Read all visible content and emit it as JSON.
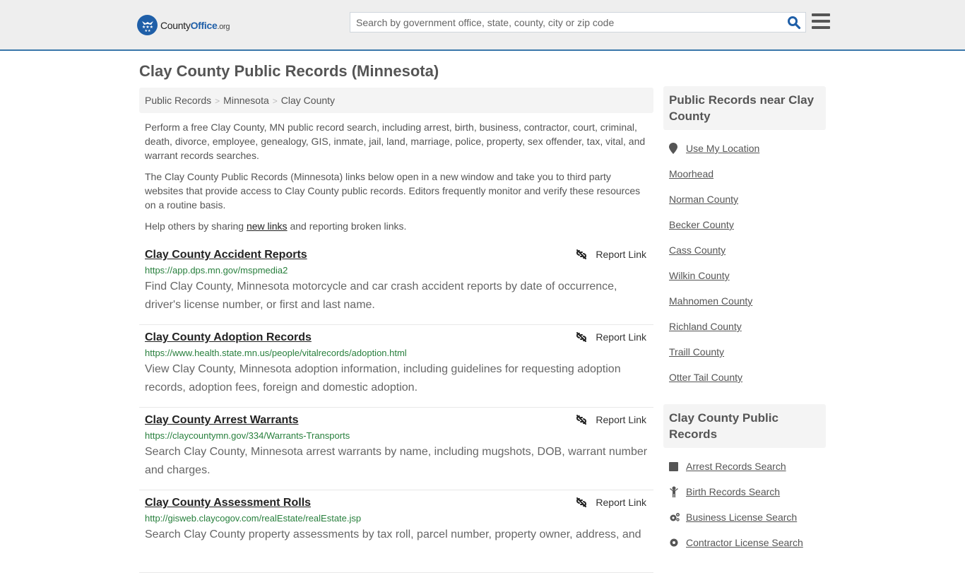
{
  "header": {
    "logo": {
      "county": "County",
      "office": "Office",
      "org": ".org"
    },
    "search": {
      "placeholder": "Search by government office, state, county, city or zip code",
      "value": ""
    },
    "colors": {
      "brand": "#1f5fa8",
      "accent_border": "#3a77aa",
      "url_green": "#277f3c"
    }
  },
  "page": {
    "title": "Clay County Public Records (Minnesota)",
    "breadcrumb": [
      {
        "label": "Public Records"
      },
      {
        "label": "Minnesota"
      },
      {
        "label": "Clay County"
      }
    ],
    "intro": {
      "p1": "Perform a free Clay County, MN public record search, including arrest, birth, business, contractor, court, criminal, death, divorce, employee, genealogy, GIS, inmate, jail, land, marriage, police, property, sex offender, tax, vital, and warrant records searches.",
      "p2": "The Clay County Public Records (Minnesota) links below open in a new window and take you to third party websites that provide access to Clay County public records. Editors frequently monitor and verify these resources on a routine basis.",
      "p3_before": "Help others by sharing ",
      "p3_link": "new links",
      "p3_after": " and reporting broken links."
    }
  },
  "records": [
    {
      "title": "Clay County Accident Reports",
      "url": "https://app.dps.mn.gov/mspmedia2",
      "description": "Find Clay County, Minnesota motorcycle and car crash accident reports by date of occurrence, driver's license number, or first and last name.",
      "report_label": "Report Link"
    },
    {
      "title": "Clay County Adoption Records",
      "url": "https://www.health.state.mn.us/people/vitalrecords/adoption.html",
      "description": "View Clay County, Minnesota adoption information, including guidelines for requesting adoption records, adoption fees, foreign and domestic adoption.",
      "report_label": "Report Link"
    },
    {
      "title": "Clay County Arrest Warrants",
      "url": "https://claycountymn.gov/334/Warrants-Transports",
      "description": "Search Clay County, Minnesota arrest warrants by name, including mugshots, DOB, warrant number and charges.",
      "report_label": "Report Link"
    },
    {
      "title": "Clay County Assessment Rolls",
      "url": "http://gisweb.claycogov.com/realEstate/realEstate.jsp",
      "description": "Search Clay County property assessments by tax roll, parcel number, property owner, address, and",
      "report_label": "Report Link"
    }
  ],
  "sidebar": {
    "nearby": {
      "heading": "Public Records near Clay County",
      "use_location": "Use My Location",
      "items": [
        "Moorhead",
        "Norman County",
        "Becker County",
        "Cass County",
        "Wilkin County",
        "Mahnomen County",
        "Richland County",
        "Traill County",
        "Otter Tail County"
      ]
    },
    "county_records": {
      "heading": "Clay County Public Records",
      "items": [
        {
          "label": "Arrest Records Search",
          "icon": "square-icon"
        },
        {
          "label": "Birth Records Search",
          "icon": "child-icon"
        },
        {
          "label": "Business License Search",
          "icon": "cogs-icon"
        },
        {
          "label": "Contractor License Search",
          "icon": "gear-icon"
        }
      ]
    }
  }
}
